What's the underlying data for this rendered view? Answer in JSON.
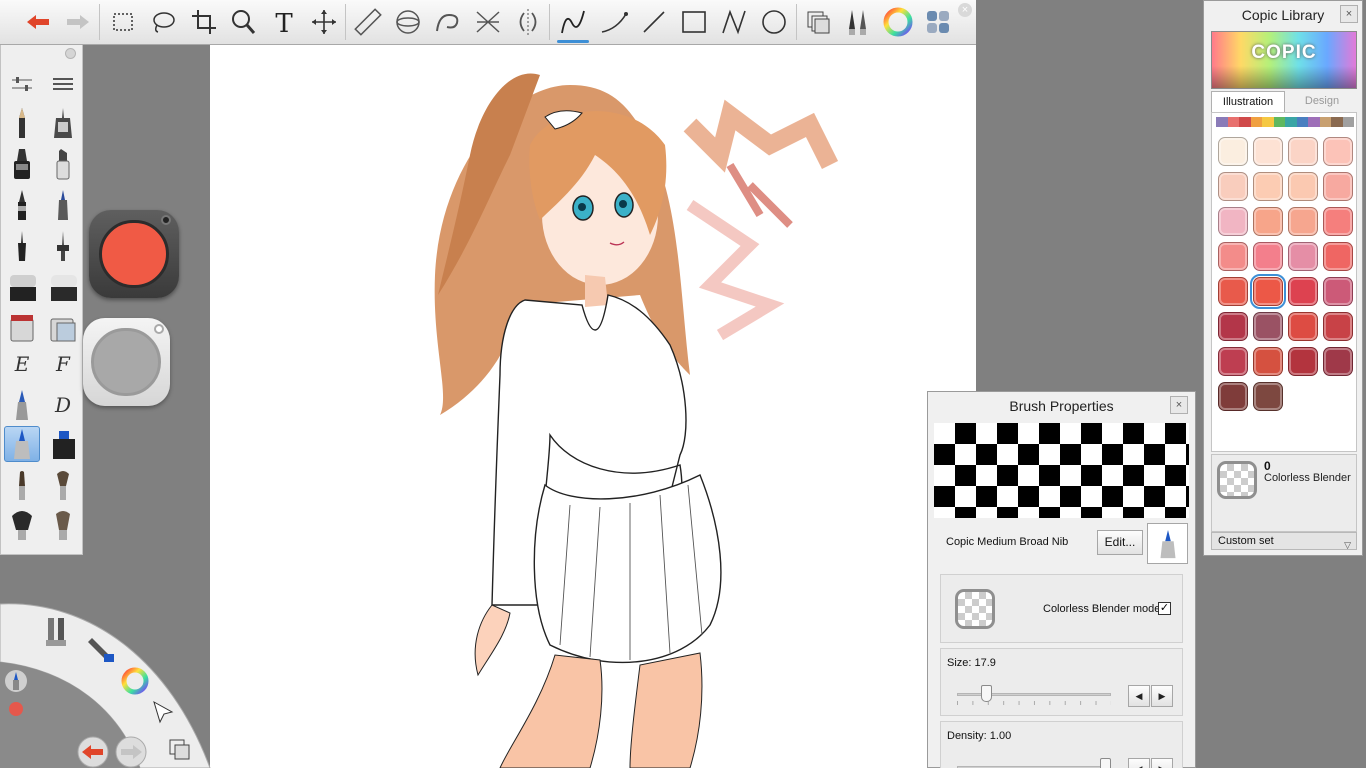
{
  "toolbar": {
    "tools": [
      "undo-icon",
      "redo-icon",
      "rect-select-icon",
      "lasso-icon",
      "crop-icon",
      "zoom-icon",
      "text-icon",
      "move-icon",
      "ruler-icon",
      "ellipse-guide-icon",
      "french-curve-icon",
      "symmetry-icon",
      "perspective-icon",
      "freehand-icon",
      "curve-icon",
      "line-icon",
      "rectangle-icon",
      "polyline-icon",
      "ellipse-icon",
      "layers-icon",
      "brushes-icon",
      "color-wheel-icon",
      "copic-icon"
    ],
    "close_label": "×"
  },
  "brush_panel": {
    "letters": [
      "E",
      "F",
      "D"
    ]
  },
  "colors": {
    "main": "#f05a45",
    "secondary": "#a8a8a8",
    "accent": "#3d8fd6"
  },
  "brush_properties": {
    "title": "Brush Properties",
    "close": "×",
    "brush_name": "Copic Medium Broad Nib",
    "edit_button": "Edit...",
    "blender_label": "Colorless Blender mode",
    "blender_checked": "✓",
    "size_label": "Size: 17.9",
    "size_value": 17.9,
    "density_label": "Density: 1.00",
    "density_value": 1.0,
    "step_left": "◀",
    "step_right": "▶"
  },
  "copic_library": {
    "title": "Copic Library",
    "close": "×",
    "logo": "COPIC",
    "tabs": [
      "Illustration",
      "Design"
    ],
    "strip_colors": [
      "#8a7bb8",
      "#e8706e",
      "#d04a4a",
      "#f0a040",
      "#f5c842",
      "#5fb85f",
      "#3aa5a5",
      "#4a7fc0",
      "#9e6fb8",
      "#c8a070",
      "#8a6a50",
      "#a0a0a0"
    ],
    "swatches": [
      "#fbeee0",
      "#fde2d4",
      "#fbd4c6",
      "#fcc3b8",
      "#f9cdbd",
      "#fcccb3",
      "#fbc9b1",
      "#f7a9a0",
      "#f1b5c3",
      "#f7a58a",
      "#f6a68f",
      "#f57f7d",
      "#f38c8a",
      "#f37f8c",
      "#e58ea6",
      "#ef6663",
      "#e85a4b",
      "#ec5847",
      "#dd4250",
      "#cc5a78",
      "#b33649",
      "#9a5264",
      "#dd4c43",
      "#c84247",
      "#be3e51",
      "#d55140",
      "#b3343e",
      "#9f3949",
      "#7f3c3a",
      "#7d4840"
    ],
    "selected_index": 17,
    "current_code": "0",
    "current_name": "Colorless Blender",
    "custom_set": "Custom set"
  }
}
